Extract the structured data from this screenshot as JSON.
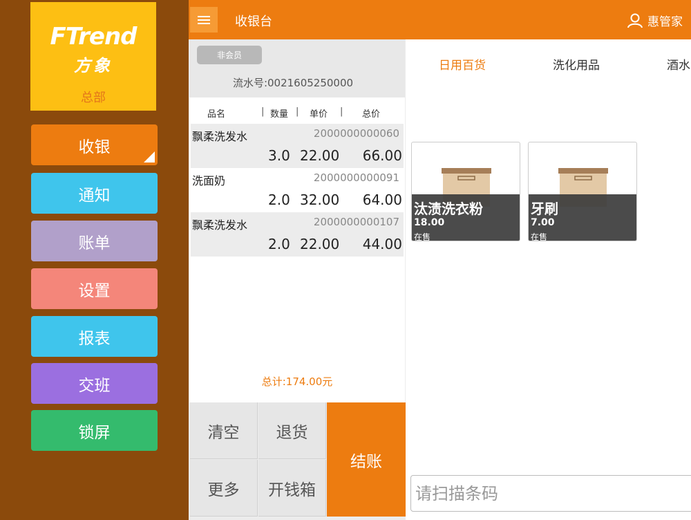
{
  "colors": {
    "sidebar_bg": "#8b4a0c",
    "accent": "#ed7c10",
    "logo_bg": "#fdbf13"
  },
  "logo": {
    "brand_en": "FTrend",
    "brand_cn": "方象",
    "store": "总部"
  },
  "nav": [
    {
      "label": "收银",
      "color": "#ed7c10",
      "active": true
    },
    {
      "label": "通知",
      "color": "#3fc5ec"
    },
    {
      "label": "账单",
      "color": "#b1a0ca"
    },
    {
      "label": "设置",
      "color": "#f4867a"
    },
    {
      "label": "报表",
      "color": "#3fc5ec"
    },
    {
      "label": "交班",
      "color": "#9b6fe0"
    },
    {
      "label": "锁屏",
      "color": "#34bb6d"
    }
  ],
  "header": {
    "title": "收银台",
    "user": "惠管家",
    "menu_icon": "hamburger-icon",
    "user_icon": "user-icon"
  },
  "ticket": {
    "member_label": "非会员",
    "serial": "流水号:0021605250000",
    "columns": [
      "品名",
      "数量",
      "单价",
      "总价"
    ],
    "items": [
      {
        "name": "飘柔洗发水",
        "code": "2000000000060",
        "qty": "3.0",
        "price": "22.00",
        "total": "66.00"
      },
      {
        "name": "洗面奶",
        "code": "2000000000091",
        "qty": "2.0",
        "price": "32.00",
        "total": "64.00"
      },
      {
        "name": "飘柔洗发水",
        "code": "2000000000107",
        "qty": "2.0",
        "price": "22.00",
        "total": "44.00"
      }
    ],
    "total": "总计:174.00元"
  },
  "actions": {
    "clear": "清空",
    "refund": "退货",
    "more": "更多",
    "open_drawer": "开钱箱",
    "checkout": "结账"
  },
  "categories": [
    {
      "label": "日用百货",
      "active": true
    },
    {
      "label": "洗化用品"
    },
    {
      "label": "酒水"
    }
  ],
  "products": [
    {
      "name": "汰渍洗衣粉",
      "price": "18.00",
      "status": "在售"
    },
    {
      "name": "牙刷",
      "price": "7.00",
      "status": "在售"
    }
  ],
  "barcode": {
    "placeholder": "请扫描条码",
    "value": ""
  }
}
